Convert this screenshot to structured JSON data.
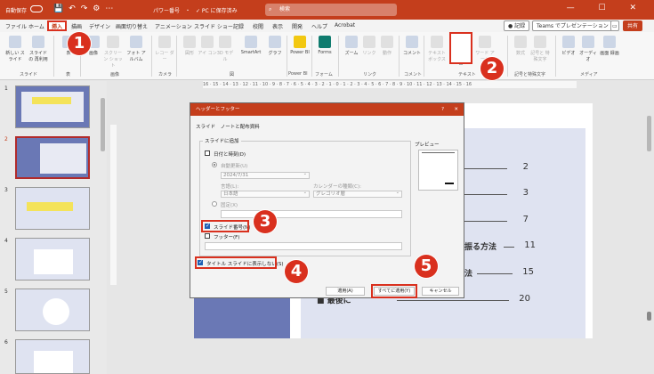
{
  "titlebar": {
    "autosave": "自動保存",
    "doc_title": "パワー番号　・　✓ PC に保存済み",
    "search": "検索",
    "window_controls": "— ☐ ✕"
  },
  "tabs": [
    "ファイル",
    "ホーム",
    "挿入",
    "描画",
    "デザイン",
    "画面切り替え",
    "アニメーション",
    "スライド ショー",
    "記録",
    "校閲",
    "表示",
    "開発",
    "ヘルプ",
    "Acrobat"
  ],
  "active_tab": "挿入",
  "toolbar_right": {
    "record": "記録",
    "teams": "Teams でプレゼンテーション",
    "share": "共有"
  },
  "ribbon": {
    "buttons": [
      "新しい\nスライド",
      "スライドの\n再利用",
      "表",
      "画像",
      "スクリーン\nショット",
      "フォト\nアルバム",
      "レコー\nダー",
      "図形",
      "アイ\nコン",
      "3D\nモデル",
      "SmartArt",
      "グラフ",
      "Power\nBI",
      "Forms",
      "ズーム",
      "リンク",
      "動作",
      "コメント",
      "テキスト\nボックス",
      "ヘッダーと\nフッター",
      "ワード\nアート",
      "数式",
      "記号と\n特殊文字",
      "ビデオ",
      "オーディオ",
      "画面\n録画"
    ],
    "groups": [
      "スライド",
      "表",
      "画像",
      "カメラ",
      "図",
      "Power BI",
      "フォーム",
      "リンク",
      "コメント",
      "テキスト",
      "記号と特殊文字",
      "メディア"
    ]
  },
  "ruler_text": "16 · 15 · 14 · 13 · 12 · 11 · 10 · 9 · 8 · 7 · 6 · 5 · 4 · 3 · 2 · 1 · 0 · 1 · 2 · 3 · 4 · 5 · 6 · 7 · 8 · 9 · 10 · 11 · 12 · 13 · 14 · 15 · 16",
  "thumbnails": [
    {
      "number": "1",
      "text": "パワーポイントで\nスライド番号を表示する方法"
    },
    {
      "number": "2",
      "text": "目次"
    },
    {
      "number": "3",
      "text": ""
    },
    {
      "number": "4",
      "text": "スライド番号を表示する方法"
    },
    {
      "number": "5",
      "text": "スライド番号を表示する方法"
    },
    {
      "number": "6",
      "text": "スライド番号を表示する方法"
    }
  ],
  "slide_toc": [
    {
      "label": "",
      "page": "2"
    },
    {
      "label": "",
      "page": "3"
    },
    {
      "label": "",
      "page": "7"
    },
    {
      "label": "振る方法",
      "page": "11"
    },
    {
      "label": "法",
      "page": "15"
    },
    {
      "label": "■ 最後に",
      "page": "20"
    }
  ],
  "dialog": {
    "title": "ヘッダーとフッター",
    "help": "?",
    "close": "✕",
    "tab_slide": "スライド",
    "tab_notes": "ノートと配布資料",
    "section_label": "スライドに追加",
    "date_time_label": "日付と時刻(D)",
    "auto_update_label": "自動更新(U)",
    "date_value": "2024/7/31",
    "language_label": "言語(L):",
    "calendar_label": "カレンダーの種類(C):",
    "language_value": "日本語",
    "calendar_value": "グレゴリオ暦",
    "fixed_label": "固定(X)",
    "slide_number_label": "スライド番号(N)",
    "footer_label": "フッター(F)",
    "title_slide_label": "タイトル スライドに表示しない(S)",
    "preview_label": "プレビュー",
    "apply_label": "適用(A)",
    "apply_all_label": "すべてに適用(Y)",
    "cancel_label": "キャンセル",
    "slide_number_checked": true,
    "title_slide_checked": true,
    "date_time_checked": false,
    "footer_checked": false
  },
  "callouts": [
    "1",
    "2",
    "3",
    "4",
    "5"
  ],
  "colors": {
    "accent": "#c43e1c",
    "highlight": "#d9301e",
    "slide_blue": "#6a78b5"
  }
}
